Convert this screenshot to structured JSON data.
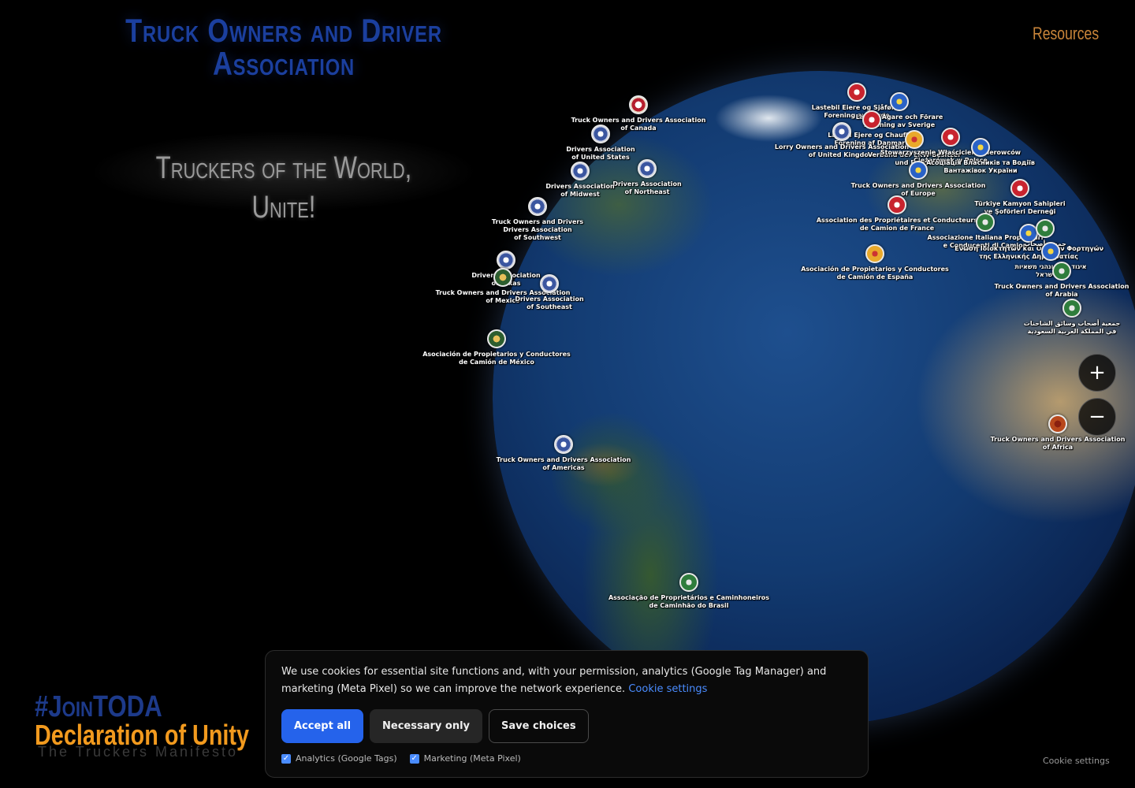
{
  "header": {
    "title": "Truck Owners and Driver Association",
    "slogan": "Truckers of the World, Unite!",
    "resources_link": "Resources"
  },
  "map": {
    "zoom_in_label": "+",
    "zoom_out_label": "−",
    "markers": [
      {
        "label": "Truck Owners and Drivers Association\nof Canada",
        "icon": "canada-emblem-icon",
        "style": "ca"
      },
      {
        "label": "Drivers Association\nof United States",
        "icon": "usa-seal-icon",
        "style": "us"
      },
      {
        "label": "Drivers Association\nof Northeast",
        "icon": "usa-seal-icon",
        "style": "us"
      },
      {
        "label": "Drivers Association\nof Midwest",
        "icon": "usa-seal-icon",
        "style": "us"
      },
      {
        "label": "Truck Owners and Drivers\nDrivers Association\nof Southwest",
        "icon": "usa-seal-icon",
        "style": "us"
      },
      {
        "label": "Drivers Association\nof Texas",
        "icon": "usa-seal-icon",
        "style": "us"
      },
      {
        "label": "Truck Owners and Drivers Association\nof Mexico",
        "icon": "mexico-emblem-icon",
        "style": "gen"
      },
      {
        "label": "Drivers Association\nof Southeast",
        "icon": "usa-seal-icon",
        "style": "us"
      },
      {
        "label": "Asociación de Propietarios y Conductores\nde Camión de México",
        "icon": "mexico-emblem-icon",
        "style": "gen"
      },
      {
        "label": "Truck Owners and Drivers Association\nof Americas",
        "icon": "americas-seal-icon",
        "style": "us"
      },
      {
        "label": "Associação de Proprietários e Caminhoneiros\nde Caminhão do Brasil",
        "icon": "brazil-emblem-icon",
        "style": "green"
      },
      {
        "label": "Lastebil Eiere og Sjåfører\nForening av Norge",
        "icon": "norway-emblem-icon",
        "style": "red"
      },
      {
        "label": "Lastbil Ägare och Förare\nFörening av Sverige",
        "icon": "sweden-emblem-icon",
        "style": "blue"
      },
      {
        "label": "Lastbil Ejere og Chauffør\nForening af Danmark",
        "icon": "denmark-emblem-icon",
        "style": "red"
      },
      {
        "label": "Lorry Owners and Drivers Association\nof United Kingdom",
        "icon": "uk-emblem-icon",
        "style": "us"
      },
      {
        "label": "Verband der LKW-Besitzer\nund Fahrer",
        "icon": "germany-emblem-icon",
        "style": "orange"
      },
      {
        "label": "Stowarzyszenie Właścicieli i Kierowców\nCiężarówek w Polsce",
        "icon": "poland-emblem-icon",
        "style": "red"
      },
      {
        "label": "Асоціація Власників та Водіїв\nВантажівок України",
        "icon": "ukraine-emblem-icon",
        "style": "blue"
      },
      {
        "label": "Truck Owners and Drivers Association\nof Europe",
        "icon": "europe-emblem-icon",
        "style": "blue"
      },
      {
        "label": "Türkiye Kamyon Sahipleri\nve Şoförleri Derneği",
        "icon": "turkey-emblem-icon",
        "style": "red"
      },
      {
        "label": "Association des Propriétaires et Conducteurs\nde Camion de France",
        "icon": "france-emblem-icon",
        "style": "red"
      },
      {
        "label": "Associazione Italiana Proprietari\ne Conducenti di Camion",
        "icon": "italy-emblem-icon",
        "style": "green"
      },
      {
        "label": "Ένωση Ιδιοκτητών και Οδηγών Φορτηγών\nτης Ελληνικής Δημοκρατίας",
        "icon": "greece-emblem-icon",
        "style": "blue"
      },
      {
        "label": "جمعية أصحاب",
        "icon": "arab-emblem-icon",
        "style": "green"
      },
      {
        "label": "איגוד בעלי ונהגי משאיות\nשל ישראל",
        "icon": "israel-emblem-icon",
        "style": "blue"
      },
      {
        "label": "Asociación de Propietarios y Conductores\nde Camión de España",
        "icon": "spain-emblem-icon",
        "style": "orange"
      },
      {
        "label": "Truck Owners and Drivers Association\nof Arabia",
        "icon": "arabia-emblem-icon",
        "style": "green"
      },
      {
        "label": "جمعية أصحاب وسائق الشاحنات\nفي المملكة العربية السعودية",
        "icon": "saudi-emblem-icon",
        "style": "green"
      },
      {
        "label": "Truck Owners and Drivers Association\nof Africa",
        "icon": "africa-emblem-icon",
        "style": "africa"
      }
    ]
  },
  "promo": {
    "hashtag": "#JoinTODA",
    "declaration": "Declaration of Unity",
    "subtitle": "The Truckers Manifesto"
  },
  "cookie_banner": {
    "text": "We use cookies for essential site functions and, with your permission, analytics (Google Tag Manager) and marketing (Meta Pixel) so we can improve the network experience.",
    "settings_link": "Cookie settings",
    "accept_all": "Accept all",
    "necessary_only": "Necessary only",
    "save_choices": "Save choices",
    "analytics_label": "Analytics (Google Tags)",
    "analytics_checked": true,
    "marketing_label": "Marketing (Meta Pixel)",
    "marketing_checked": true
  },
  "footer": {
    "cookie_settings": "Cookie settings"
  }
}
